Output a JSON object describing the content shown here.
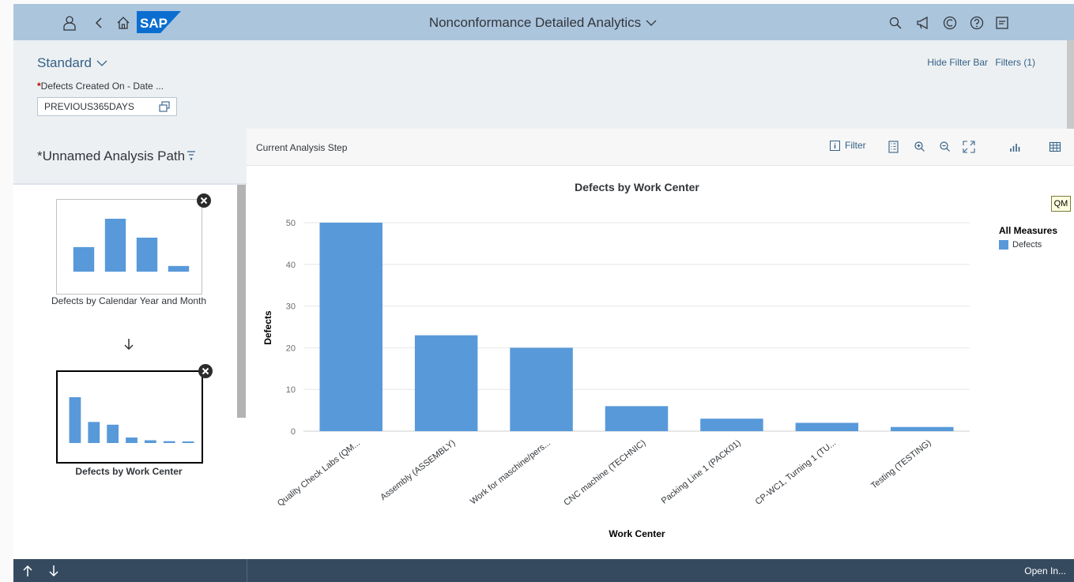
{
  "shell": {
    "app_title": "Nonconformance Detailed Analytics",
    "logo_text": "SAP",
    "colors": {
      "bar": "#abc5dd",
      "logo": "#0a6ed1",
      "icon": "#32363a"
    }
  },
  "filter_bar": {
    "variant": "Standard",
    "filter_required_mark": "*",
    "filter_label": "Defects Created On - Date ...",
    "filter_value": "PREVIOUS365DAYS",
    "hide_filter_bar": "Hide Filter Bar",
    "filters": "Filters (1)"
  },
  "analysis_path": {
    "title": "*Unnamed Analysis Path",
    "steps": [
      {
        "title": "Defects by Calendar Year and Month",
        "thumbnail_values": [
          13,
          28,
          18,
          3
        ]
      },
      {
        "title": "Defects by Work Center",
        "thumbnail_values": [
          50,
          23,
          20,
          6,
          3,
          2,
          1
        ]
      }
    ]
  },
  "toolbar": {
    "step_label": "Current Analysis Step",
    "filter_button": "Filter",
    "icons": [
      "legend-icon",
      "zoom-in-icon",
      "zoom-out-icon",
      "fullscreen-icon",
      "bar-chart-icon",
      "table-icon"
    ]
  },
  "chart_data": {
    "type": "bar",
    "title": "Defects by Work Center",
    "xlabel": "Work Center",
    "ylabel": "Defects",
    "categories": [
      "Quality Check Labs (QM...",
      "Assembly (ASSEMBLY)",
      "Work for maschine/pers...",
      "CNC machine (TECHNIC)",
      "Packing Line 1 (PACK01)",
      "CP-WC1, Turning 1 (TU...",
      "Testing (TESTING)"
    ],
    "series": [
      {
        "name": "Defects",
        "values": [
          50,
          23,
          20,
          6,
          3,
          2,
          1
        ]
      }
    ],
    "ylim": [
      0,
      50
    ],
    "yticks": [
      0,
      10,
      20,
      30,
      40,
      50
    ],
    "grid": true,
    "legend_title": "All Measures",
    "legend_position": "right",
    "bar_color": "#5899da",
    "tag": "QM"
  },
  "footer": {
    "open_in": "Open In..."
  }
}
